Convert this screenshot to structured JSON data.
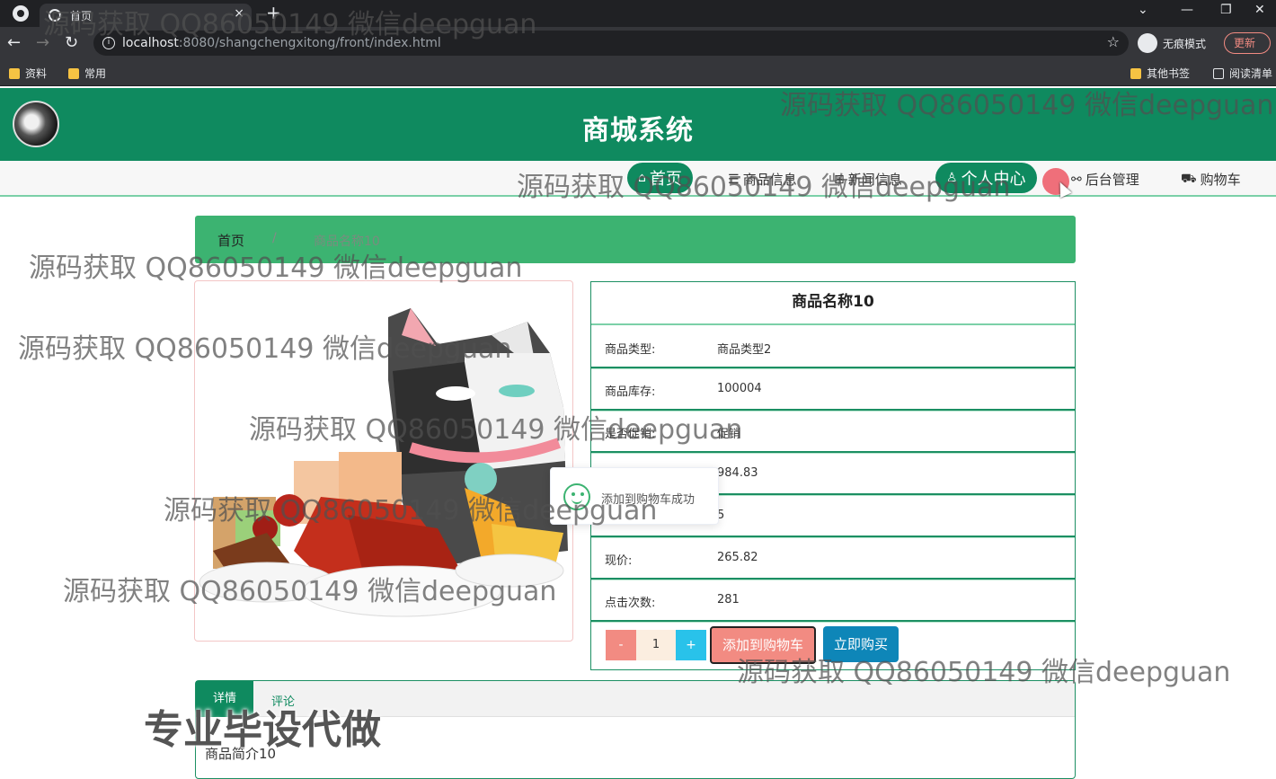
{
  "browser": {
    "tab_title": "首页",
    "tab_close": "×",
    "new_tab": "+",
    "url_host": "localhost",
    "url_rest": ":8080/shangchengxitong/front/index.html",
    "incognito_label": "无痕模式",
    "update_label": "更新",
    "bookmarks": [
      "资料",
      "常用"
    ],
    "bookmarks_right": [
      "其他书签",
      "阅读清单"
    ]
  },
  "header": {
    "site_title": "商城系统"
  },
  "nav": {
    "items": [
      "首页",
      "商品信息",
      "新闻信息",
      "个人中心",
      "后台管理",
      "购物车"
    ]
  },
  "breadcrumb": {
    "home": "首页",
    "sep": "/",
    "current": "商品名称10"
  },
  "product": {
    "name": "商品名称10",
    "rows": [
      {
        "label": "商品类型:",
        "value": "商品类型2"
      },
      {
        "label": "商品库存:",
        "value": "100004"
      },
      {
        "label": "是否促销:",
        "value": "促销"
      },
      {
        "label": "",
        "value": "984.83"
      },
      {
        "label": "",
        "value": "5"
      },
      {
        "label": "现价:",
        "value": "265.82"
      },
      {
        "label": "点击次数:",
        "value": "281"
      }
    ],
    "quantity": "1",
    "minus": "-",
    "plus": "+",
    "add_to_cart": "添加到购物车",
    "buy_now": "立即购买"
  },
  "toast": {
    "message": "添加到购物车成功"
  },
  "tabs": {
    "detail": "详情",
    "comment": "评论",
    "content": "商品简介10"
  },
  "watermark": {
    "text": "源码获取 QQ86050149 微信deepguan",
    "big": "专业毕设代做"
  },
  "colors": {
    "brand_green": "#0f8a5f",
    "breadcrumb_green": "#3cb371",
    "add_cart_pink": "#f28b82",
    "buy_blue": "#0e86b8"
  }
}
